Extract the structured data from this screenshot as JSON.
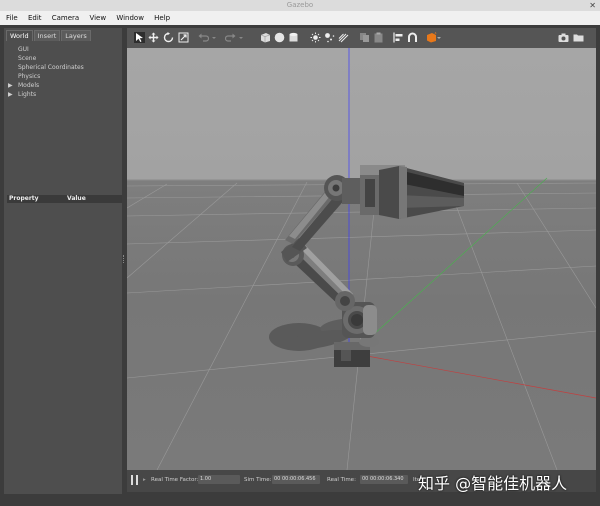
{
  "window": {
    "title": "Gazebo",
    "close_glyph": "✕"
  },
  "menu": [
    "File",
    "Edit",
    "Camera",
    "View",
    "Window",
    "Help"
  ],
  "left_panel": {
    "tabs": [
      "World",
      "Insert",
      "Layers"
    ],
    "tree": [
      {
        "label": "GUI",
        "expandable": false
      },
      {
        "label": "Scene",
        "expandable": false
      },
      {
        "label": "Spherical Coordinates",
        "expandable": false
      },
      {
        "label": "Physics",
        "expandable": false
      },
      {
        "label": "Models",
        "expandable": true
      },
      {
        "label": "Lights",
        "expandable": true
      }
    ],
    "property_header": {
      "col1": "Property",
      "col2": "Value"
    }
  },
  "bottom_bar": {
    "real_time_factor_label": "Real Time Factor:",
    "real_time_factor": "1.00",
    "sim_time_label": "Sim Time:",
    "sim_time": "00 00:00:06.456",
    "real_time_label": "Real Time:",
    "real_time": "00 00:00:06.340",
    "iterations_label": "Ite"
  },
  "watermark": "知乎 @智能佳机器人",
  "colors": {
    "accent_orange": "#e8781a",
    "axis_blue": "#3a3aff",
    "axis_green": "#4caf50",
    "axis_red": "#c04040"
  }
}
